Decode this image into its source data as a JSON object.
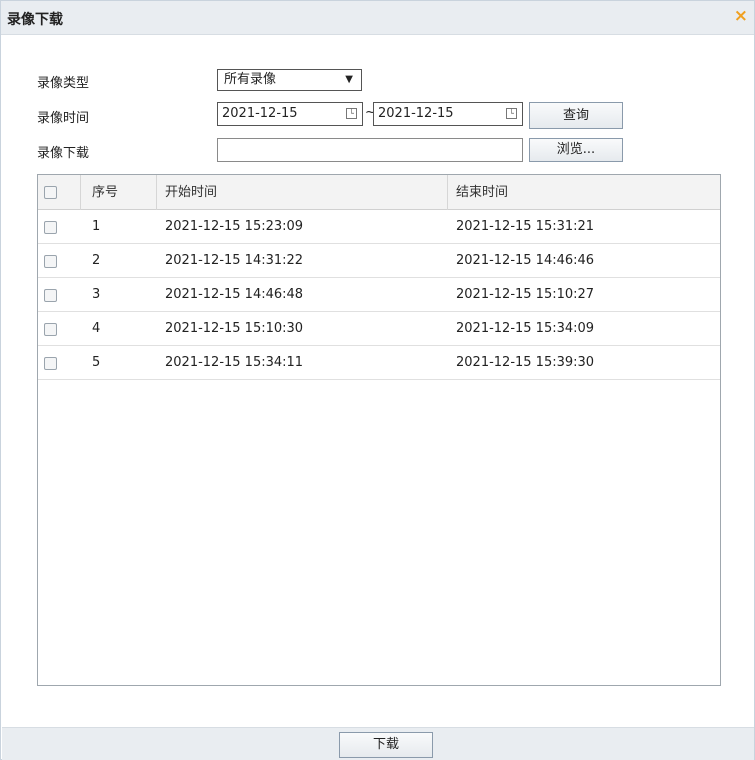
{
  "dialog": {
    "title": "录像下载",
    "close_glyph": "×"
  },
  "form": {
    "type_label": "录像类型",
    "type_value": "所有录像",
    "time_label": "录像时间",
    "start_date": "2021-12-15",
    "tilde": "~",
    "end_date": "2021-12-15",
    "query_label": "查询",
    "download_label": "录像下载",
    "path_value": "",
    "browse_label": "浏览..."
  },
  "table": {
    "columns": {
      "index": "序号",
      "start": "开始时间",
      "end": "结束时间"
    },
    "rows": [
      {
        "index": "1",
        "start": "2021-12-15 15:23:09",
        "end": "2021-12-15 15:31:21"
      },
      {
        "index": "2",
        "start": "2021-12-15 14:31:22",
        "end": "2021-12-15 14:46:46"
      },
      {
        "index": "3",
        "start": "2021-12-15 14:46:48",
        "end": "2021-12-15 15:10:27"
      },
      {
        "index": "4",
        "start": "2021-12-15 15:10:30",
        "end": "2021-12-15 15:34:09"
      },
      {
        "index": "5",
        "start": "2021-12-15 15:34:11",
        "end": "2021-12-15 15:39:30"
      }
    ]
  },
  "footer": {
    "download_button": "下载"
  },
  "colors": {
    "close_icon": "#f0a020",
    "titlebar": "#e9edf1"
  }
}
